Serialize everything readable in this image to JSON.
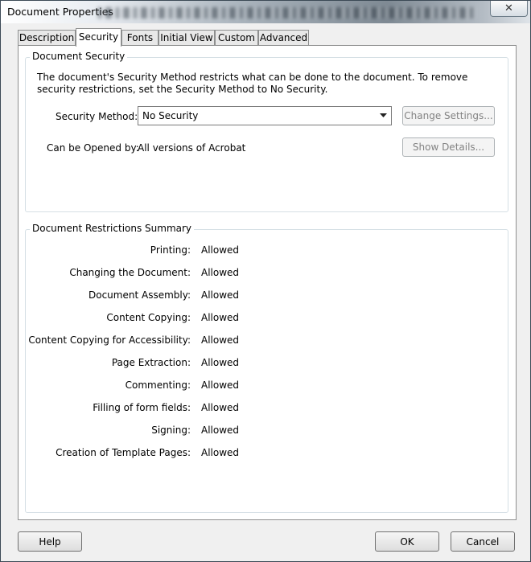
{
  "window": {
    "title": "Document Properties",
    "close_glyph": "✕"
  },
  "tabs": [
    {
      "label": "Description"
    },
    {
      "label": "Security"
    },
    {
      "label": "Fonts"
    },
    {
      "label": "Initial View"
    },
    {
      "label": "Custom"
    },
    {
      "label": "Advanced"
    }
  ],
  "security": {
    "group_title": "Document Security",
    "description": "The document's Security Method restricts what can be done to the document. To remove security restrictions, set the Security Method to No Security.",
    "method_label": "Security Method:",
    "method_value": "No Security",
    "change_settings_label": "Change Settings...",
    "opened_by_label": "Can be Opened by:",
    "opened_by_value": "All versions of Acrobat",
    "show_details_label": "Show Details..."
  },
  "restrictions": {
    "group_title": "Document Restrictions Summary",
    "rows": [
      {
        "label": "Printing:",
        "value": "Allowed"
      },
      {
        "label": "Changing the Document:",
        "value": "Allowed"
      },
      {
        "label": "Document Assembly:",
        "value": "Allowed"
      },
      {
        "label": "Content Copying:",
        "value": "Allowed"
      },
      {
        "label": "Content Copying for Accessibility:",
        "value": "Allowed"
      },
      {
        "label": "Page Extraction:",
        "value": "Allowed"
      },
      {
        "label": "Commenting:",
        "value": "Allowed"
      },
      {
        "label": "Filling of form fields:",
        "value": "Allowed"
      },
      {
        "label": "Signing:",
        "value": "Allowed"
      },
      {
        "label": "Creation of Template Pages:",
        "value": "Allowed"
      }
    ]
  },
  "footer": {
    "help_label": "Help",
    "ok_label": "OK",
    "cancel_label": "Cancel"
  },
  "icons": {
    "close": "close-icon",
    "dropdown": "chevron-down-icon"
  },
  "colors": {
    "panel_bg": "#ffffff",
    "dialog_bg": "#f0f0f0",
    "group_border": "#d5dfe5",
    "disabled_text": "#838383"
  }
}
